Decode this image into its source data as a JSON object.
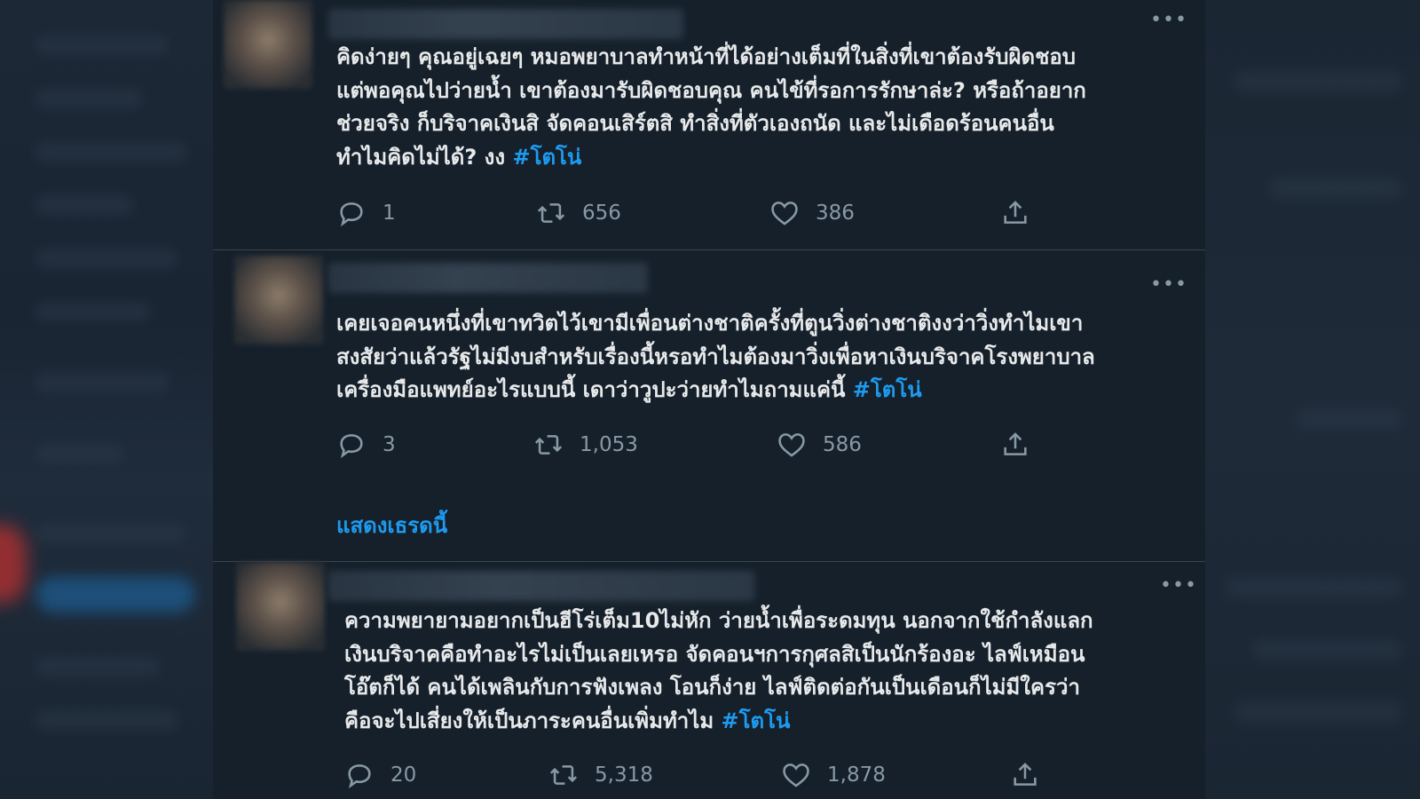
{
  "tweets": [
    {
      "lines": [
        "คิดง่ายๆ คุณอยู่เฉยๆ หมอพยาบาลทำหน้าที่ได้อย่างเต็มที่ในสิ่งที่เขาต้องรับผิดชอบ",
        "แต่พอคุณไปว่ายน้ำ เขาต้องมารับผิดชอบคุณ คนไข้ที่รอการรักษาล่ะ? หรือถ้าอยาก",
        "ช่วยจริง ก็บริจาคเงินสิ จัดคอนเสิร์ตสิ ทำสิ่งที่ตัวเองถนัด และไม่เดือดร้อนคนอื่น",
        "ทำไมคิดไม่ได้? งง"
      ],
      "hashtag": "#โตโน่",
      "replies": "1",
      "retweets": "656",
      "likes": "386"
    },
    {
      "lines": [
        "เคยเจอคนหนึ่งที่เขาทวิตไว้เขามีเพื่อนต่างชาติครั้งที่ตูนวิ่งต่างชาติงงว่าวิ่งทำไมเขา",
        "สงสัยว่าแล้วรัฐไม่มีงบสำหรับเรื่องนี้หรอทำไมต้องมาวิ่งเพื่อหาเงินบริจาคโรงพยาบาล",
        "เครื่องมือแพทย์อะไรแบบนี้ เดาว่าวูปะว่ายทำไมถามแค่นี้"
      ],
      "hashtag": "#โตโน่",
      "replies": "3",
      "retweets": "1,053",
      "likes": "586",
      "show_thread": "แสดงเธรดนี้"
    },
    {
      "lines": [
        "ความพยายามอยากเป็นฮีโร่เต็ม10ไม่หัก ว่ายน้ำเพื่อระดมทุน นอกจากใช้กำลังแลก",
        "เงินบริจาคคือทำอะไรไม่เป็นเลยเหรอ จัดคอนฯการกุศลสิเป็นนักร้องอะ ไลฟ์เหมือน",
        "โอ๊ตก็ได้ คนได้เพลินกับการฟังเพลง โอนก็ง่าย ไลฟ์ติดต่อกันเป็นเดือนก็ไม่มีใครว่า",
        "คือจะไปเสี่ยงให้เป็นภาระคนอื่นเพิ่มทำไม"
      ],
      "hashtag": "#โตโน่",
      "replies": "20",
      "retweets": "5,318",
      "likes": "1,878"
    }
  ],
  "icons": {
    "reply": "reply-icon",
    "retweet": "retweet-icon",
    "like": "heart-icon",
    "share": "share-icon",
    "more": "more-icon"
  },
  "colors": {
    "background": "#15202b",
    "text": "#e7e9ea",
    "muted": "#8899a6",
    "accent": "#1d9bf0",
    "divider": "#38444d"
  }
}
